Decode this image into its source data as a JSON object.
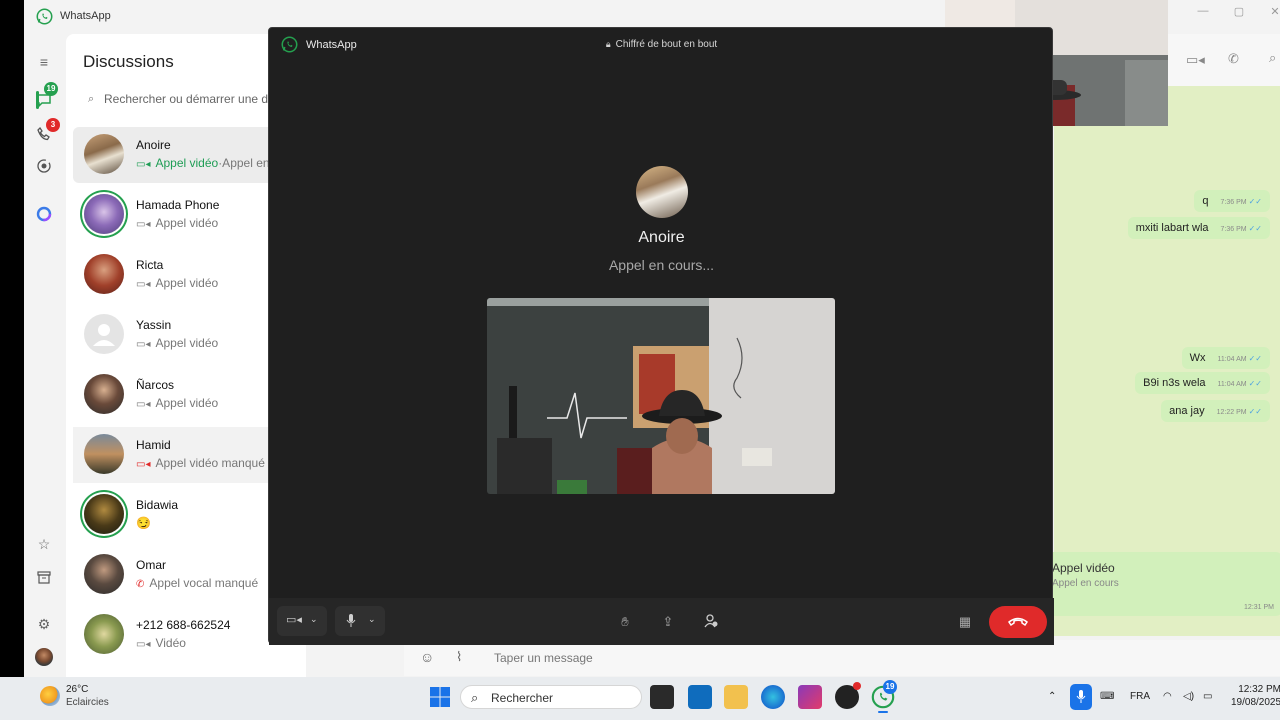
{
  "app": {
    "title": "WhatsApp"
  },
  "nav": {
    "chats_badge": "19",
    "calls_badge": "3"
  },
  "chatlist": {
    "title": "Discussions",
    "search_placeholder": "Rechercher ou démarrer une dis",
    "items": [
      {
        "name": "Anoire",
        "sub_prefix": "Appel vidéo",
        "sub_suffix": "·Appel en c",
        "sub_style": "green",
        "icon": "video-icon"
      },
      {
        "name": "Hamada Phone",
        "sub": "Appel vidéo",
        "icon": "video-icon"
      },
      {
        "name": "Ricta",
        "sub": "Appel vidéo",
        "icon": "video-icon"
      },
      {
        "name": "Yassin",
        "sub": "Appel vidéo",
        "icon": "video-icon"
      },
      {
        "name": "Ñarcos",
        "sub": "Appel vidéo",
        "icon": "video-icon"
      },
      {
        "name": "Hamid",
        "sub": "Appel vidéo manqué",
        "icon": "missed-video-icon"
      },
      {
        "name": "Bidawia",
        "sub": "😏",
        "icon": ""
      },
      {
        "name": "Omar",
        "sub": "Appel vocal manqué",
        "icon": "missed-voice-icon"
      },
      {
        "name": "+212 688-662524",
        "sub": "Vidéo",
        "icon": "video-icon"
      }
    ]
  },
  "call": {
    "window_title": "WhatsApp",
    "encryption": "Chiffré de bout en bout",
    "contact_name": "Anoire",
    "status": "Appel en cours..."
  },
  "conversation": {
    "messages": [
      {
        "text": "q",
        "time": "7:36 PM"
      },
      {
        "text": "mxiti labart wla",
        "time": "7:36 PM"
      },
      {
        "text": "Wx",
        "time": "11:04 AM"
      },
      {
        "text": "B9i n3s wela",
        "time": "11:04 AM"
      },
      {
        "text": "ana jay",
        "time": "12:22 PM"
      }
    ],
    "call_card": {
      "title": "Appel vidéo",
      "sub": "Appel en cours",
      "time": "12:31 PM"
    },
    "composer_placeholder": "Taper un message"
  },
  "taskbar": {
    "temperature": "26°C",
    "weather": "Eclaircies",
    "search": "Rechercher",
    "whatsapp_badge": "19",
    "language": "FRA",
    "time": "12:32 PM",
    "date": "19/08/2025"
  },
  "colors": {
    "accent": "#25a04f",
    "end_call": "#e02a2a",
    "bubble": "#d2f0bb",
    "check": "#4fa3e0"
  }
}
